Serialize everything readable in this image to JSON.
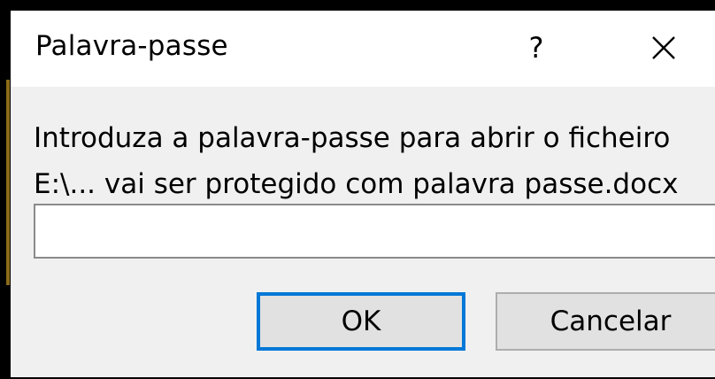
{
  "window": {
    "title": "Palavra-passe",
    "help_glyph": "?",
    "close_icon": "close-icon"
  },
  "message": {
    "line1": "Introduza a palavra-passe para abrir o ficheiro",
    "line2": "E:\\... vai ser protegido com palavra passe.docx"
  },
  "password_field": {
    "value": "",
    "placeholder": ""
  },
  "buttons": {
    "ok_label": "OK",
    "cancel_label": "Cancelar"
  },
  "colors": {
    "focus_border": "#0078d7",
    "dialog_background": "#f0f0f0",
    "titlebar_background": "#ffffff"
  }
}
